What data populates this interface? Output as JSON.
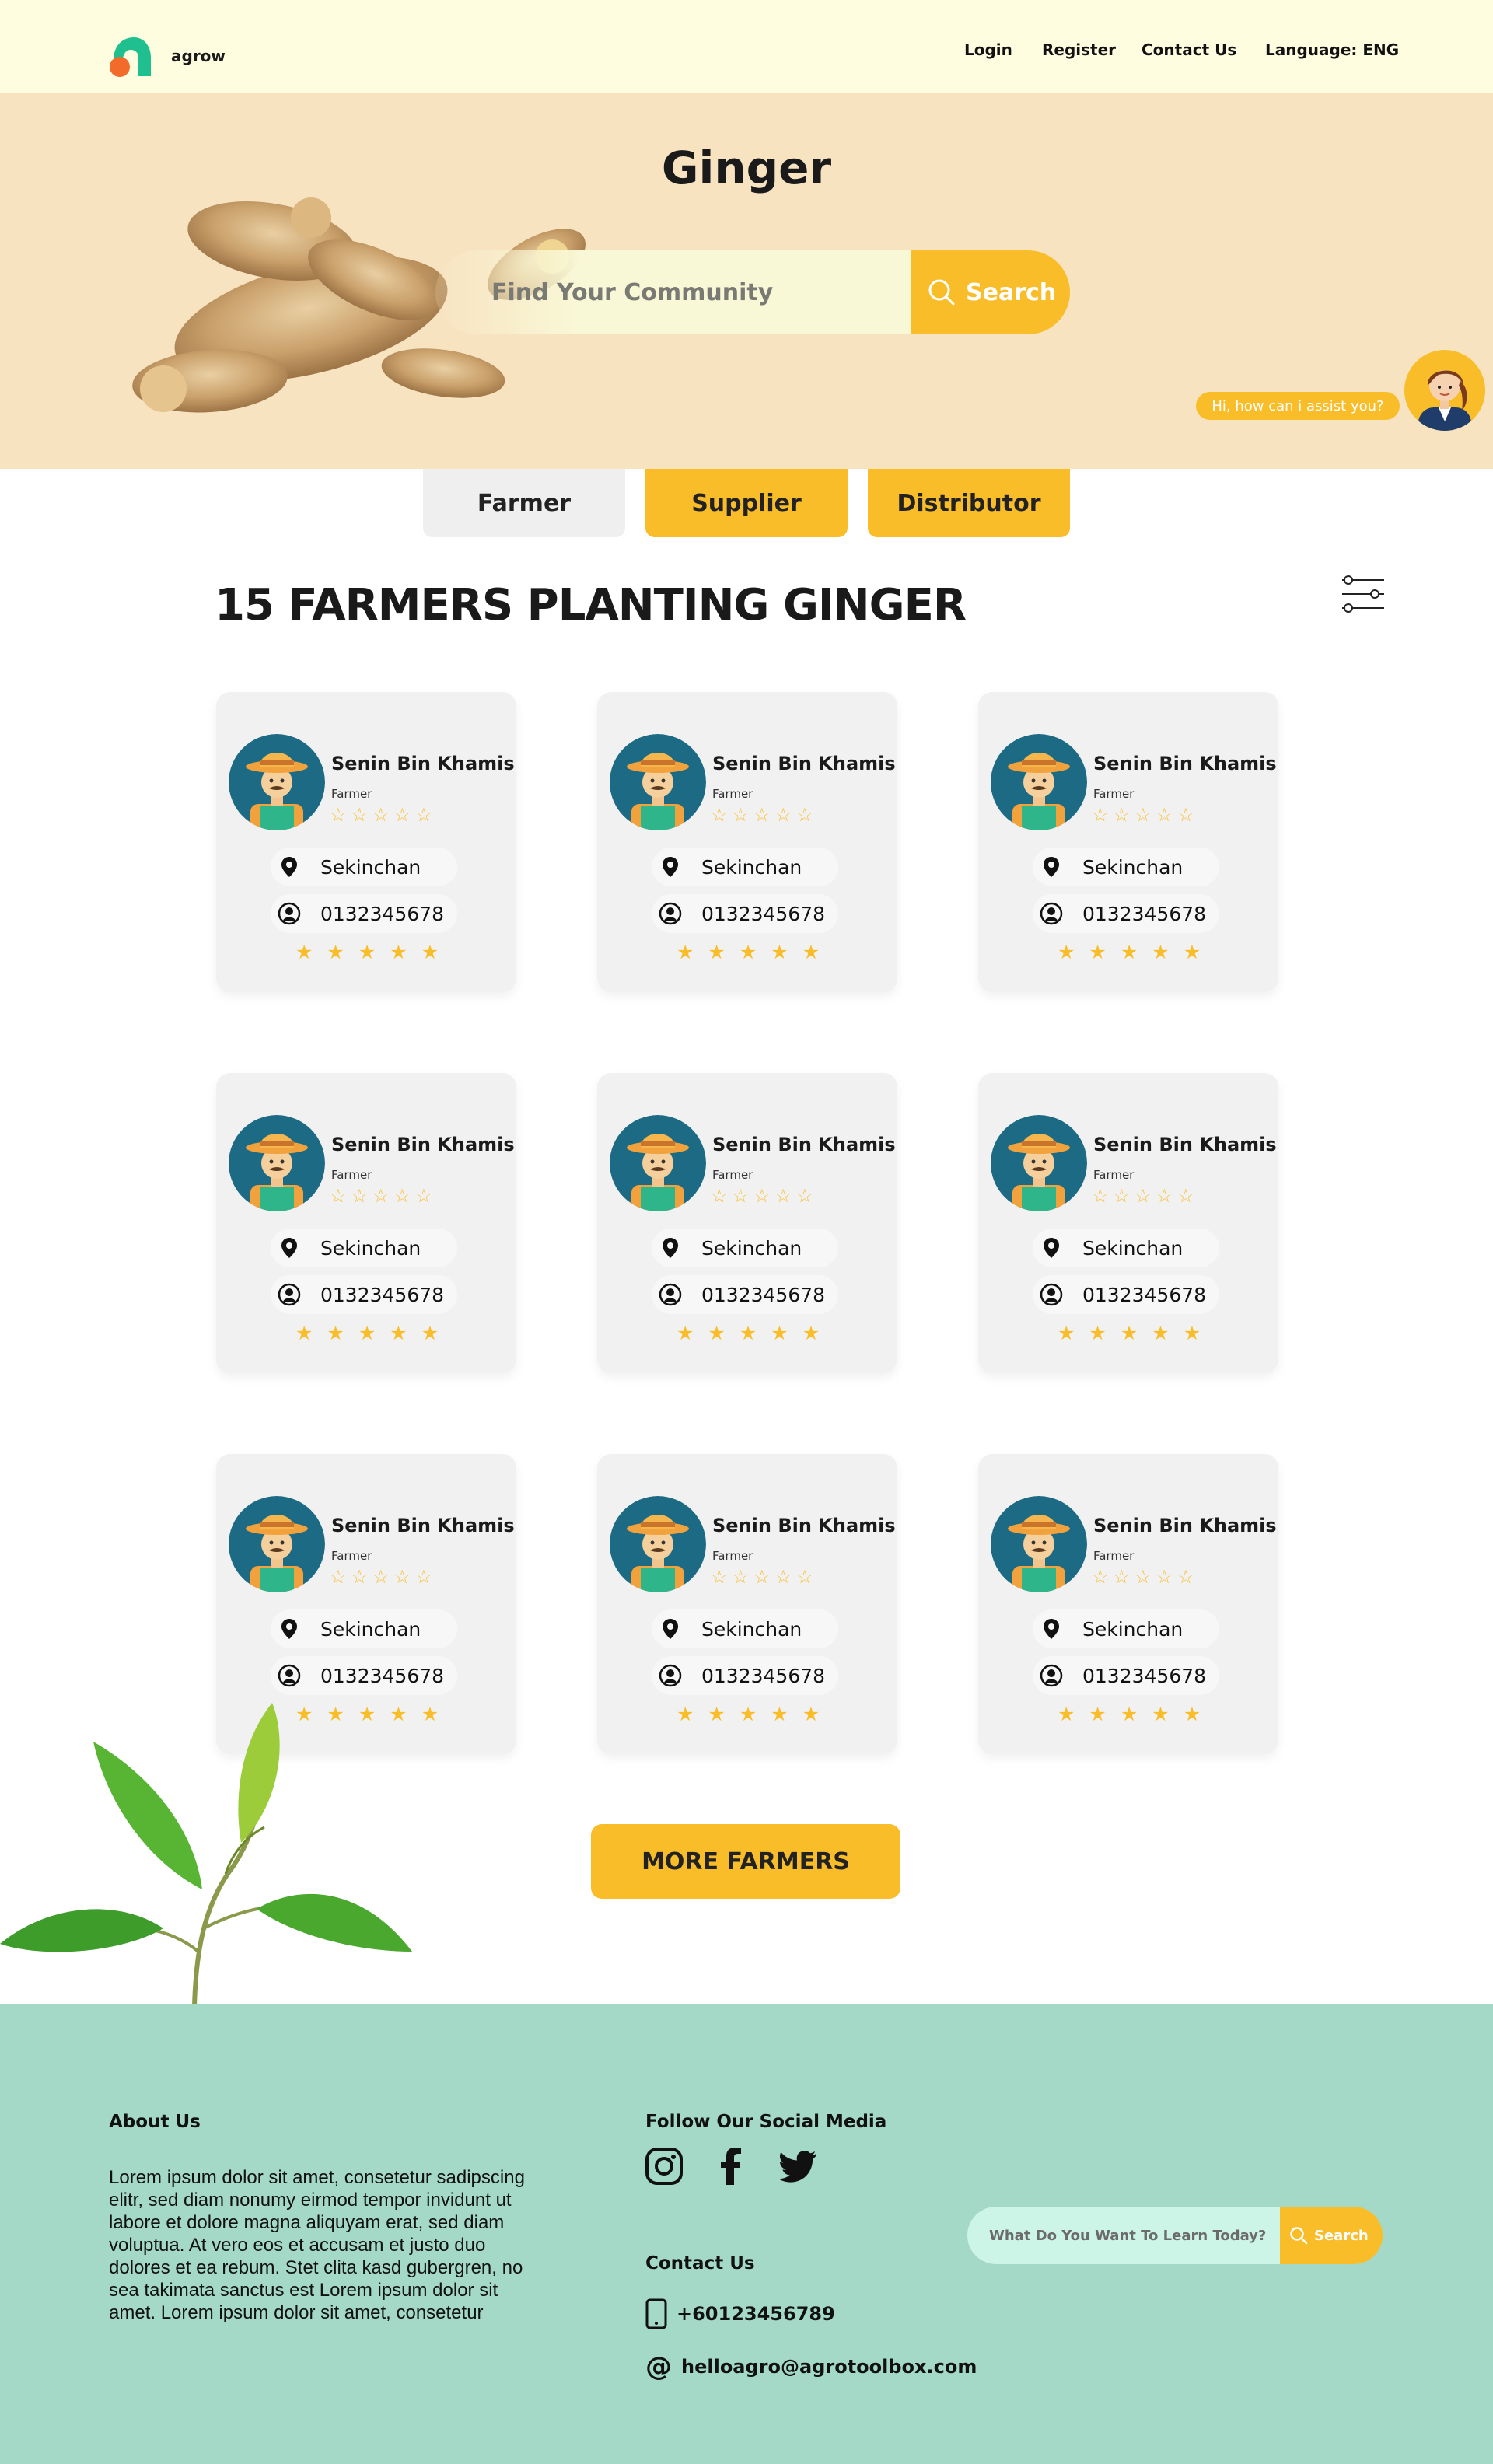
{
  "nav": {
    "brand": "agrow",
    "links": {
      "login": "Login",
      "register": "Register",
      "contact": "Contact Us",
      "language": "Language: ENG"
    }
  },
  "hero": {
    "title": "Ginger",
    "search_placeholder": "Find Your Community",
    "search_button": "Search",
    "chat_prompt": "Hi, how can i assist you?"
  },
  "tabs": {
    "farmer": "Farmer",
    "supplier": "Supplier",
    "distributor": "Distributor"
  },
  "section": {
    "title": "15 FARMERS PLANTING GINGER"
  },
  "cards": [
    {
      "name": "Senin Bin Khamis",
      "role": "Farmer",
      "location": "Sekinchan",
      "phone": "0132345678",
      "rating_outline": "☆☆☆☆☆",
      "rating_solid": 5
    },
    {
      "name": "Senin Bin Khamis",
      "role": "Farmer",
      "location": "Sekinchan",
      "phone": "0132345678",
      "rating_outline": "☆☆☆☆☆",
      "rating_solid": 5
    },
    {
      "name": "Senin Bin Khamis",
      "role": "Farmer",
      "location": "Sekinchan",
      "phone": "0132345678",
      "rating_outline": "☆☆☆☆☆",
      "rating_solid": 5
    },
    {
      "name": "Senin Bin Khamis",
      "role": "Farmer",
      "location": "Sekinchan",
      "phone": "0132345678",
      "rating_outline": "☆☆☆☆☆",
      "rating_solid": 5
    },
    {
      "name": "Senin Bin Khamis",
      "role": "Farmer",
      "location": "Sekinchan",
      "phone": "0132345678",
      "rating_outline": "☆☆☆☆☆",
      "rating_solid": 5
    },
    {
      "name": "Senin Bin Khamis",
      "role": "Farmer",
      "location": "Sekinchan",
      "phone": "0132345678",
      "rating_outline": "☆☆☆☆☆",
      "rating_solid": 5
    },
    {
      "name": "Senin Bin Khamis",
      "role": "Farmer",
      "location": "Sekinchan",
      "phone": "0132345678",
      "rating_outline": "☆☆☆☆☆",
      "rating_solid": 5
    },
    {
      "name": "Senin Bin Khamis",
      "role": "Farmer",
      "location": "Sekinchan",
      "phone": "0132345678",
      "rating_outline": "☆☆☆☆☆",
      "rating_solid": 5
    },
    {
      "name": "Senin Bin Khamis",
      "role": "Farmer",
      "location": "Sekinchan",
      "phone": "0132345678",
      "rating_outline": "☆☆☆☆☆",
      "rating_solid": 5
    }
  ],
  "more_button": "MORE FARMERS",
  "footer": {
    "about_heading": "About Us",
    "about_text": "Lorem ipsum dolor sit amet, consetetur sadipscing elitr, sed diam nonumy eirmod tempor invidunt ut labore et dolore magna aliquyam erat, sed diam voluptua. At vero eos et accusam et justo duo dolores et ea rebum. Stet clita kasd gubergren, no sea takimata sanctus est Lorem ipsum dolor sit amet. Lorem ipsum dolor sit amet, consetetur",
    "social_heading": "Follow Our Social Media",
    "social_icons": [
      "instagram-icon",
      "facebook-icon",
      "twitter-icon"
    ],
    "contact_heading": "Contact Us",
    "phone": "+60123456789",
    "email": "helloagro@agrotoolbox.com",
    "search_placeholder": "What Do You Want To Learn Today?",
    "search_button": "Search"
  },
  "colors": {
    "accent": "#f9bd2a",
    "nav_bg": "#fffddf",
    "hero_bg": "#f8e3c1",
    "footer_bg": "#a3d9c6",
    "brand_green": "#1fbf8f",
    "brand_orange": "#f26b2a"
  }
}
